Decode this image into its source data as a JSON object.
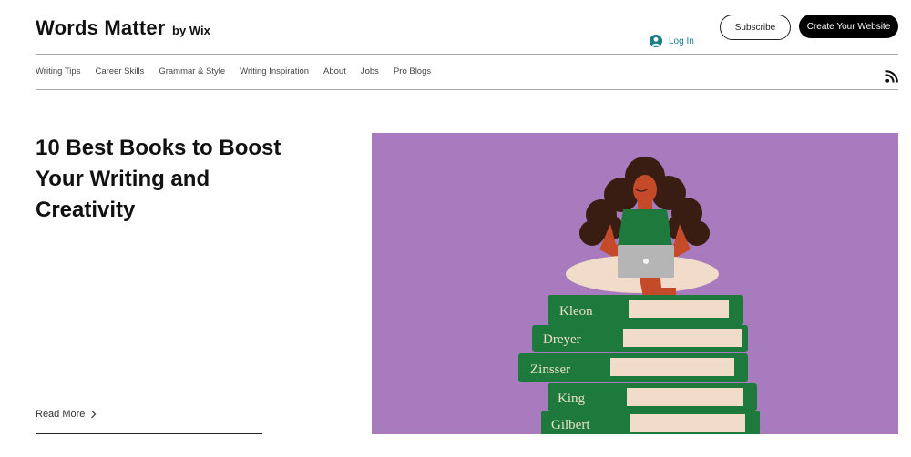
{
  "header": {
    "logo_main": "Words Matter",
    "logo_by": "by Wix",
    "subscribe_label": "Subscribe",
    "create_label": "Create Your Website",
    "login_label": "Log In"
  },
  "nav": {
    "items": [
      {
        "label": "Writing Tips"
      },
      {
        "label": "Career Skills"
      },
      {
        "label": "Grammar & Style"
      },
      {
        "label": "Writing Inspiration"
      },
      {
        "label": "About"
      },
      {
        "label": "Jobs"
      },
      {
        "label": "Pro Blogs"
      }
    ]
  },
  "post": {
    "title": "10 Best Books to Boost Your Writing and Creativity",
    "read_more_label": "Read More"
  },
  "hero": {
    "books": [
      "Kleon",
      "Dreyer",
      "Zinsser",
      "King",
      "Gilbert"
    ]
  },
  "colors": {
    "hero_bg": "#a77bbd",
    "book_green": "#1d7a3c",
    "pages": "#f0dcc8",
    "accent_teal": "#1c7e8c"
  }
}
